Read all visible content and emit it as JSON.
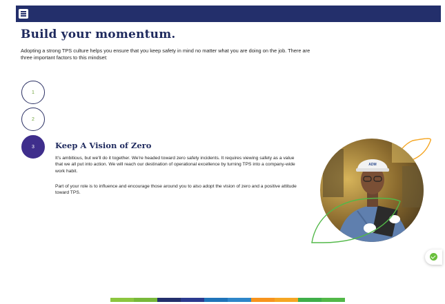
{
  "topbar": {
    "menu_icon": "hamburger-menu-icon"
  },
  "page": {
    "title": "Build your momentum.",
    "intro": "Adopting a strong TPS culture helps you ensure that you keep safety in mind no matter what you are doing on the job. There are three important factors to this mindset:"
  },
  "steps": [
    {
      "number": "1",
      "active": false
    },
    {
      "number": "2",
      "active": false
    },
    {
      "number": "3",
      "active": true
    }
  ],
  "section": {
    "title": "Keep A Vision of Zero",
    "paragraph_1": "It's ambitious, but we'll do it together. We're headed toward zero safety incidents. It requires viewing safety as a value that we all put into action. We will reach our destination of operational excellence by turning TPS into a company-wide work habit.",
    "paragraph_2": "Part of your role is to influence and encourage those around you to also adopt the vision of zero and a positive attitude toward TPS."
  },
  "photo": {
    "helmet_logo": "ADM"
  },
  "complete_button": {
    "icon": "check-circle-icon"
  },
  "colors": {
    "nav": "#232f6b",
    "accent_purple": "#3f2e8c",
    "step_number_green": "#6fa33a",
    "leaf_green": "#52b848",
    "leaf_orange": "#f5a623"
  },
  "progress_strip": [
    "#8cc63f",
    "#78b83a",
    "#232f6b",
    "#2b3a8f",
    "#1f74b9",
    "#2e86c9",
    "#f7941d",
    "#f5a623",
    "#3fae49",
    "#52b848"
  ]
}
